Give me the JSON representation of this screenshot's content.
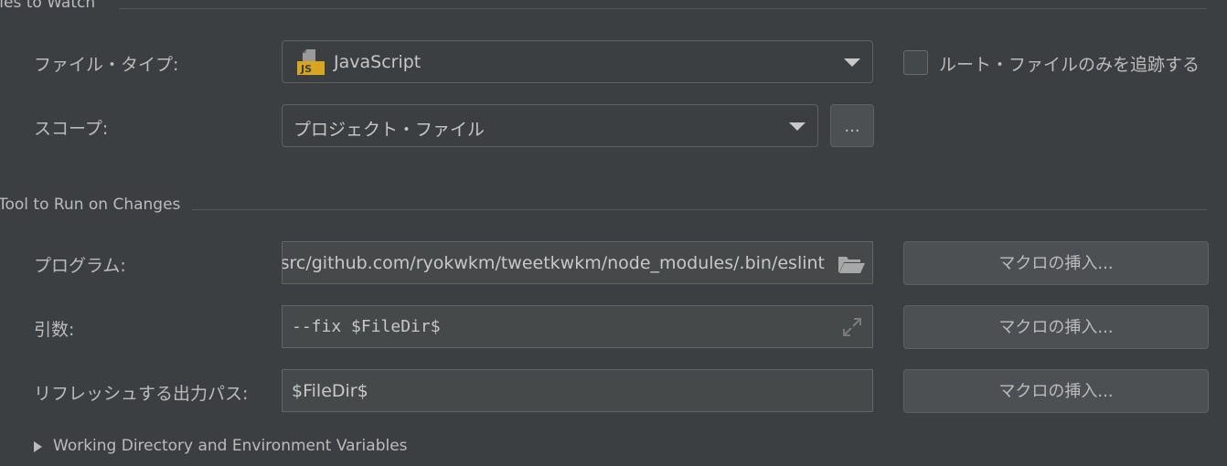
{
  "files_to_watch": {
    "title": "Files to Watch",
    "file_type_label": "ファイル・タイプ:",
    "file_type_value": "JavaScript",
    "file_type_icon": "javascript-file-icon",
    "track_root_label": "ルート・ファイルのみを追跡する",
    "track_root_checked": false,
    "scope_label": "スコープ:",
    "scope_value": "プロジェクト・ファイル",
    "scope_browse_label": "..."
  },
  "tool_to_run": {
    "title": "Tool to Run on Changes",
    "program_label": "プログラム:",
    "program_value": "src/github.com/ryokwkm/tweetkwkm/node_modules/.bin/eslint",
    "arguments_label": "引数:",
    "arguments_value": "--fix $FileDir$",
    "output_paths_label": "リフレッシュする出力パス:",
    "output_paths_value": "$FileDir$",
    "insert_macro_label": "マクロの挿入..."
  },
  "working_dir_section": {
    "label": "Working Directory and Environment Variables",
    "expanded": false
  },
  "colors": {
    "background": "#3c3f41",
    "text": "#bbbbbb",
    "field_background": "#45494a",
    "js_icon_yellow": "#d9a520"
  }
}
